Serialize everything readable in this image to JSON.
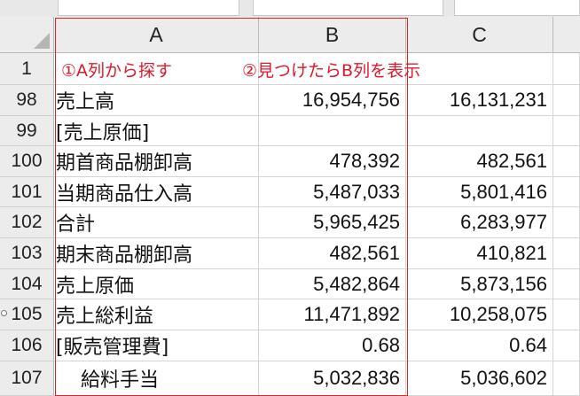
{
  "column_headers": [
    "A",
    "B",
    "C"
  ],
  "annotation": {
    "note_a": "①A列から探す",
    "note_b": "②見つけたらB列を表示"
  },
  "rows": [
    {
      "num": "1",
      "a": "",
      "b": "",
      "c": ""
    },
    {
      "num": "98",
      "a": "売上高",
      "b": "16,954,756",
      "c": "16,131,231"
    },
    {
      "num": "99",
      "a": "[売上原価]",
      "b": "",
      "c": ""
    },
    {
      "num": "100",
      "a": "期首商品棚卸高",
      "b": "478,392",
      "c": "482,561"
    },
    {
      "num": "101",
      "a": "当期商品仕入高",
      "b": "5,487,033",
      "c": "5,801,416"
    },
    {
      "num": "102",
      "a": "合計",
      "b": "5,965,425",
      "c": "6,283,977"
    },
    {
      "num": "103",
      "a": "期末商品棚卸高",
      "b": "482,561",
      "c": "410,821"
    },
    {
      "num": "104",
      "a": "売上原価",
      "b": "5,482,864",
      "c": "5,873,156"
    },
    {
      "num": "105",
      "a": "売上総利益",
      "b": "11,471,892",
      "c": "10,258,075"
    },
    {
      "num": "106",
      "a": "[販売管理費]",
      "b": "0.68",
      "c": "0.64"
    },
    {
      "num": "107",
      "a": "給料手当",
      "b": "5,032,836",
      "c": "5,036,602"
    }
  ],
  "colors": {
    "annotation_red": "#e0192b",
    "header_bg": "#ececec"
  }
}
